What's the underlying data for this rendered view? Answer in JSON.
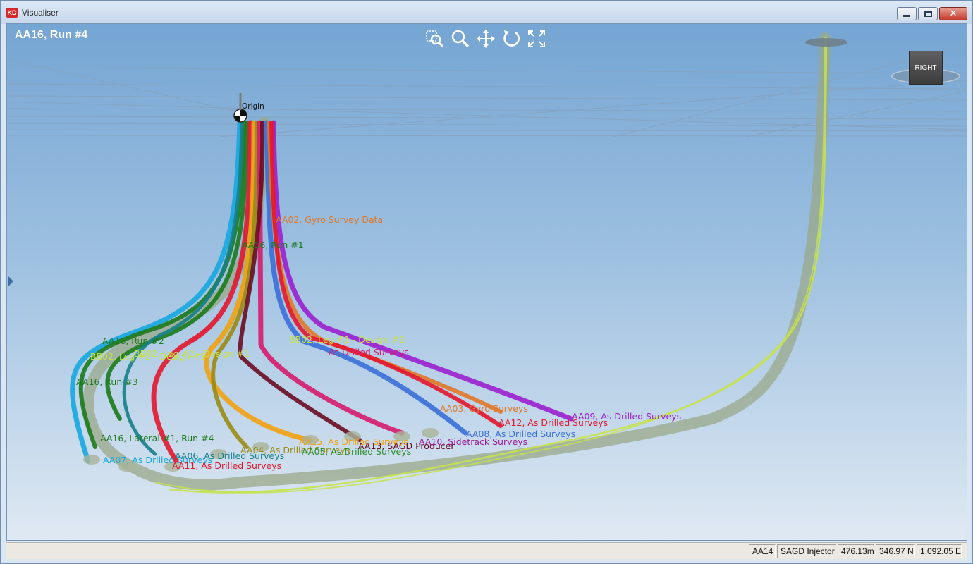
{
  "window": {
    "app_icon": "KD",
    "title": "Visualiser",
    "controls": {
      "minimize_icon": "minimize-icon",
      "maximize_icon": "maximize-icon",
      "close_icon": "close-icon"
    }
  },
  "viewport": {
    "run_title": "AA16, Run #4",
    "toolbar": [
      {
        "name": "zoom-window-icon"
      },
      {
        "name": "zoom-icon"
      },
      {
        "name": "pan-icon"
      },
      {
        "name": "rotate-icon"
      },
      {
        "name": "fit-extents-icon"
      }
    ],
    "view_cube_label": "RIGHT",
    "origin_label": "Origin",
    "well_labels": [
      {
        "text": "AA02, Gyro Survey Data",
        "color": "#e0782a"
      },
      {
        "text": "AA16, Run #1",
        "color": "#1b7a1b"
      },
      {
        "text": "AA16, Run #2",
        "color": "#1b7a1b"
      },
      {
        "text": "BB02, Leg #2 - Design #1",
        "color": "#c6e24b"
      },
      {
        "text": "BB02, Leg #2 - Design #1",
        "color": "#c6e24b"
      },
      {
        "text": "BB02, Leg #1 - Design #1",
        "color": "#c6e24b"
      },
      {
        "text": "As Drilled Surveys",
        "color": "#d61b6e"
      },
      {
        "text": "AA16, Run #3",
        "color": "#1b7a1b"
      },
      {
        "text": "AA16, Lateral #1, Run #4",
        "color": "#1b7a1b"
      },
      {
        "text": "AA07, As Drilled Surveys",
        "color": "#16a7e0"
      },
      {
        "text": "AA06, As Drilled Surveys",
        "color": "#16808a"
      },
      {
        "text": "AA11, As Drilled Surveys",
        "color": "#e3162c"
      },
      {
        "text": "AA04, As Drilled Surveys",
        "color": "#9a8a12"
      },
      {
        "text": "AA05, As Drilled Surveys",
        "color": "#2d8f2d"
      },
      {
        "text": "AA15, As Drilled Surveys",
        "color": "#f2a10f"
      },
      {
        "text": "AA13, SAGD Producer",
        "color": "#6a0b24"
      },
      {
        "text": "AA10, Sidetrack Surveys",
        "color": "#9a1b9a"
      },
      {
        "text": "AA08, As Drilled Surveys",
        "color": "#3a6fd8"
      },
      {
        "text": "AA12, As Drilled Surveys",
        "color": "#e3162c"
      },
      {
        "text": "AA09, As Drilled Surveys",
        "color": "#9b1fcf"
      },
      {
        "text": "AA03, Gyro Surveys",
        "color": "#e0782a"
      }
    ]
  },
  "status": {
    "well": "AA14",
    "type": "SAGD Injector",
    "depth": "476.13m",
    "northing": "346.97 N",
    "easting": "1,092.05 E"
  }
}
